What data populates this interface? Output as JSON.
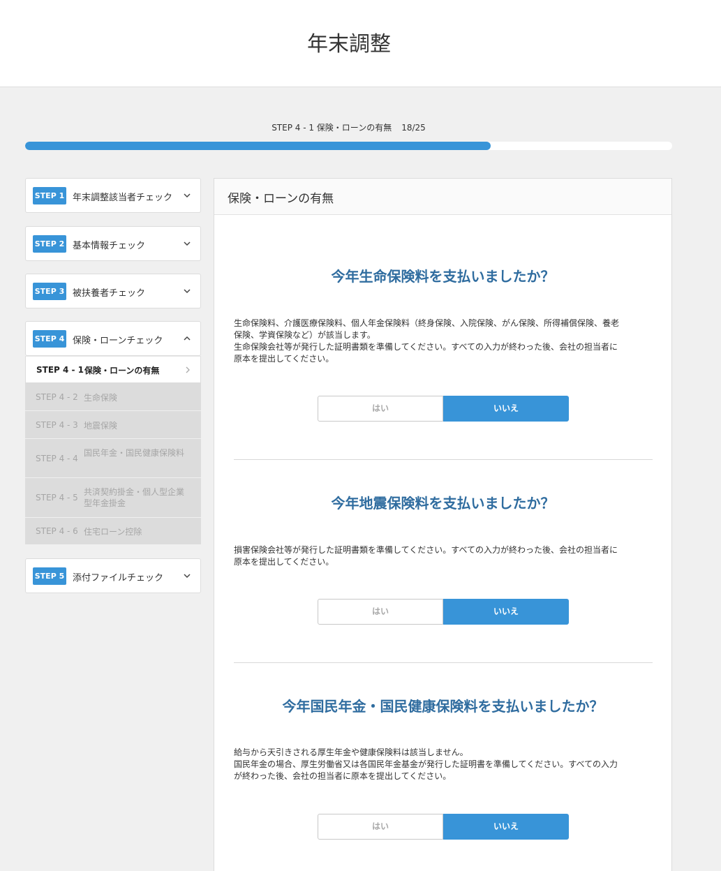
{
  "app_title": "年末調整",
  "progress": {
    "label": "STEP 4 - 1 保険・ローンの有無",
    "count": "18/25",
    "fraction": 0.72
  },
  "sidebar": {
    "steps": [
      {
        "badge": "STEP 1",
        "label": "年末調整該当者チェック",
        "chevron": "chevron-down-icon"
      },
      {
        "badge": "STEP 2",
        "label": "基本情報チェック",
        "chevron": "chevron-down-icon"
      },
      {
        "badge": "STEP 3",
        "label": "被扶養者チェック",
        "chevron": "chevron-down-icon"
      },
      {
        "badge": "STEP 4",
        "label": "保険・ローンチェック",
        "chevron": "chevron-up-icon"
      },
      {
        "badge": "STEP 5",
        "label": "添付ファイルチェック",
        "chevron": "chevron-down-icon"
      }
    ],
    "substeps": [
      {
        "num": "STEP 4 - 1",
        "name": "保険・ローンの有無"
      },
      {
        "num": "STEP 4 - 2",
        "name": "生命保険"
      },
      {
        "num": "STEP 4 - 3",
        "name": "地震保険"
      },
      {
        "num": "STEP 4 - 4",
        "name": "国民年金・国民健康保険料"
      },
      {
        "num": "STEP 4 - 5",
        "name": "共済契約掛金・個人型企業型年金掛金"
      },
      {
        "num": "STEP 4 - 6",
        "name": "住宅ローン控除"
      }
    ]
  },
  "main": {
    "title": "保険・ローンの有無",
    "questions": [
      {
        "title": "今年生命保険料を支払いましたか？",
        "desc": [
          "生命保険料、介護医療保険料、個人年金保険料（終身保険、入院保険、がん保険、所得補償保険、養老",
          "保険、学資保険など）が該当します。",
          "生命保険会社等が発行した証明書類を準備してください。すべての入力が終わった後、会社の担当者に",
          "原本を提出してください。"
        ],
        "yes": "はい",
        "no": "いいえ"
      },
      {
        "title": "今年地震保険料を支払いましたか？",
        "desc": [
          "損害保険会社等が発行した証明書類を準備してください。すべての入力が終わった後、会社の担当者に",
          "原本を提出してください。"
        ],
        "yes": "はい",
        "no": "いいえ"
      },
      {
        "title": "今年国民年金・国民健康保険料を支払いましたか？",
        "desc": [
          "給与から天引きされる厚生年金や健康保険料は該当しません。",
          "国民年金の場合、厚生労働省又は各国民年金基金が発行した証明書を準備してください。すべての入力",
          "が終わった後、会社の担当者に原本を提出してください。"
        ],
        "yes": "はい",
        "no": "いいえ"
      }
    ]
  },
  "colors": {
    "accent": "#3894d8",
    "question_title": "#2f6c9f",
    "disabled_bg": "#dcdcdc",
    "disabled_text": "#a6a6a6"
  }
}
